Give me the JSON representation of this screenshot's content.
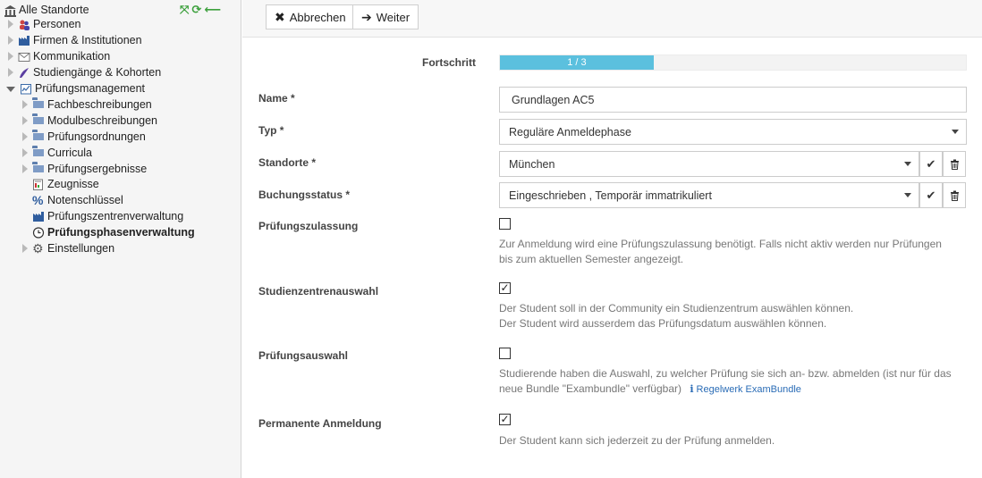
{
  "sidebar": {
    "root": {
      "label": "Alle Standorte",
      "icon": "building-icon"
    },
    "tools": [
      "expand-icon",
      "refresh-icon",
      "back-arrow-icon"
    ],
    "items": [
      {
        "label": "Personen",
        "icon": "people-icon"
      },
      {
        "label": "Firmen & Institutionen",
        "icon": "factory-icon"
      },
      {
        "label": "Kommunikation",
        "icon": "envelope-icon"
      },
      {
        "label": "Studiengänge & Kohorten",
        "icon": "graduation-icon"
      },
      {
        "label": "Prüfungsmanagement",
        "icon": "exam-icon"
      },
      {
        "label": "Fachbeschreibungen",
        "icon": "folder-icon"
      },
      {
        "label": "Modulbeschreibungen",
        "icon": "folder-icon"
      },
      {
        "label": "Prüfungsordnungen",
        "icon": "folder-icon"
      },
      {
        "label": "Curricula",
        "icon": "folder-icon"
      },
      {
        "label": "Prüfungsergebnisse",
        "icon": "folder-icon"
      },
      {
        "label": "Zeugnisse",
        "icon": "certificate-icon"
      },
      {
        "label": "Notenschlüssel",
        "icon": "percent-icon"
      },
      {
        "label": "Prüfungszentrenverwaltung",
        "icon": "factory-icon"
      },
      {
        "label": "Prüfungsphasenverwaltung",
        "icon": "clock-icon"
      },
      {
        "label": "Einstellungen",
        "icon": "gear-icon"
      }
    ]
  },
  "toolbar": {
    "cancel_label": "Abbrechen",
    "next_label": "Weiter"
  },
  "form": {
    "progress_label": "Fortschritt",
    "progress_text": "1 / 3",
    "progress_value": 0.33,
    "progress_color": "#5bc0de",
    "name": {
      "label": "Name *",
      "value": "Grundlagen AC5"
    },
    "typ": {
      "label": "Typ *",
      "value": "Reguläre Anmeldephase"
    },
    "standorte": {
      "label": "Standorte *",
      "value": "München"
    },
    "buchungsstatus": {
      "label": "Buchungsstatus *",
      "value": "Eingeschrieben , Temporär immatrikuliert"
    },
    "pruefungszulassung": {
      "label": "Prüfungszulassung",
      "checked": false,
      "help1": "Zur Anmeldung wird eine Prüfungszulassung benötigt. Falls nicht aktiv werden nur Prüfungen",
      "help2": "bis zum aktuellen Semester angezeigt."
    },
    "studienzentrenauswahl": {
      "label": "Studienzentrenauswahl",
      "checked": true,
      "help1": "Der Student soll in der Community ein Studienzentrum auswählen können.",
      "help2": "Der Student wird ausserdem das Prüfungsdatum auswählen können."
    },
    "pruefungsauswahl": {
      "label": "Prüfungsauswahl",
      "checked": false,
      "help1": "Studierende haben die Auswahl, zu welcher Prüfung sie sich an- bzw. abmelden (ist nur für das",
      "help2": "neue Bundle \"Exambundle\" verfügbar)",
      "link": "Regelwerk ExamBundle",
      "link_icon": "info-icon"
    },
    "permanente_anmeldung": {
      "label": "Permanente Anmeldung",
      "checked": true,
      "help1": "Der Student kann sich jederzeit zu der Prüfung anmelden."
    }
  }
}
